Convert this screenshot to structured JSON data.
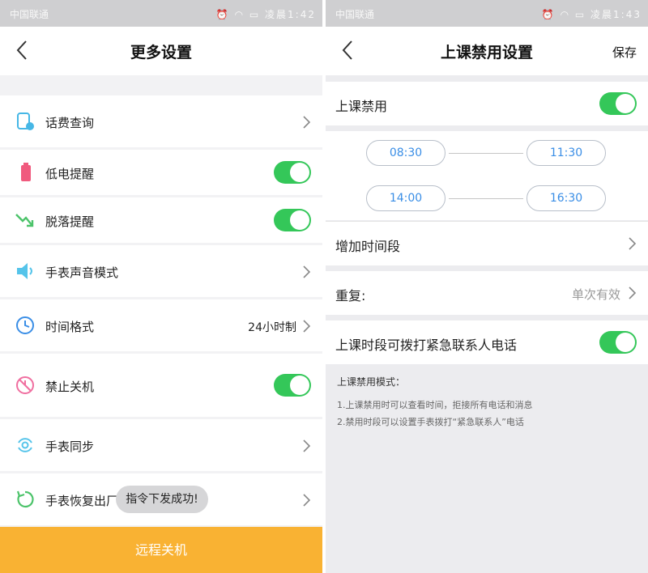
{
  "left": {
    "status": {
      "carrier": "中国联通",
      "time": "凌晨1:42"
    },
    "nav": {
      "title": "更多设置"
    },
    "items": [
      {
        "label": "话费查询"
      },
      {
        "label": "低电提醒"
      },
      {
        "label": "脱落提醒"
      },
      {
        "label": "手表声音模式"
      },
      {
        "label": "时间格式",
        "value": "24小时制"
      },
      {
        "label": "禁止关机"
      },
      {
        "label": "手表同步"
      },
      {
        "label": "手表恢复出厂"
      }
    ],
    "toast": "指令下发成功!",
    "bottom_button": "远程关机"
  },
  "right": {
    "status": {
      "carrier": "中国联通",
      "time": "凌晨1:43"
    },
    "nav": {
      "title": "上课禁用设置",
      "save": "保存"
    },
    "disable_label": "上课禁用",
    "periods": [
      {
        "start": "08:30",
        "end": "11:30"
      },
      {
        "start": "14:00",
        "end": "16:30"
      }
    ],
    "add_period": "增加时间段",
    "repeat": {
      "label": "重复:",
      "value": "单次有效"
    },
    "emergency_label": "上课时段可拨打紧急联系人电话",
    "notes": {
      "title": "上课禁用模式：",
      "line1": "1.上课禁用时可以查看时间，拒接所有电话和消息",
      "line2": "2.禁用时段可以设置手表拨打“紧急联系人”电话"
    }
  },
  "colors": {
    "accent_green": "#34c759",
    "bottom_orange": "#f9b233",
    "time_blue": "#3a8ee6"
  }
}
